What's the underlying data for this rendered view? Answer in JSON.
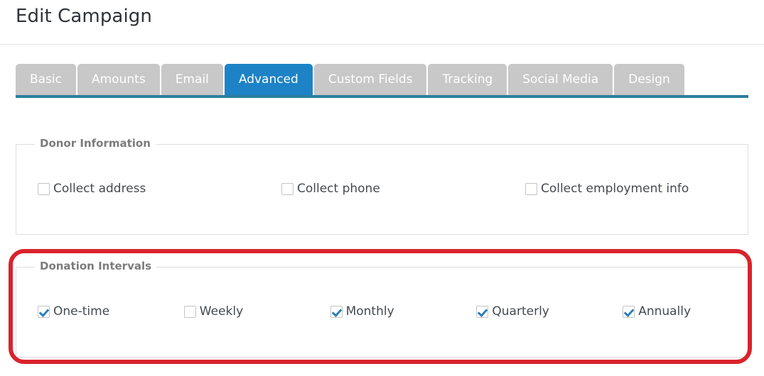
{
  "header": {
    "title": "Edit Campaign"
  },
  "tabs": [
    {
      "label": "Basic",
      "active": false
    },
    {
      "label": "Amounts",
      "active": false
    },
    {
      "label": "Email",
      "active": false
    },
    {
      "label": "Advanced",
      "active": true
    },
    {
      "label": "Custom Fields",
      "active": false
    },
    {
      "label": "Tracking",
      "active": false
    },
    {
      "label": "Social Media",
      "active": false
    },
    {
      "label": "Design",
      "active": false
    }
  ],
  "sections": {
    "donor_information": {
      "legend": "Donor Information",
      "checkboxes": [
        {
          "label": "Collect address",
          "checked": false
        },
        {
          "label": "Collect phone",
          "checked": false
        },
        {
          "label": "Collect employment info",
          "checked": false
        }
      ]
    },
    "donation_intervals": {
      "legend": "Donation Intervals",
      "highlighted": true,
      "checkboxes": [
        {
          "label": "One-time",
          "checked": true
        },
        {
          "label": "Weekly",
          "checked": false
        },
        {
          "label": "Monthly",
          "checked": true
        },
        {
          "label": "Quarterly",
          "checked": true
        },
        {
          "label": "Annually",
          "checked": true
        }
      ]
    }
  },
  "colors": {
    "active_tab": "#1d83c6",
    "inactive_tab": "#c8c8c8",
    "tab_underline": "#2c7e9f",
    "checkmark": "#2e7fb8",
    "highlight": "#d9232b",
    "legend_text": "#7b7b7b"
  }
}
